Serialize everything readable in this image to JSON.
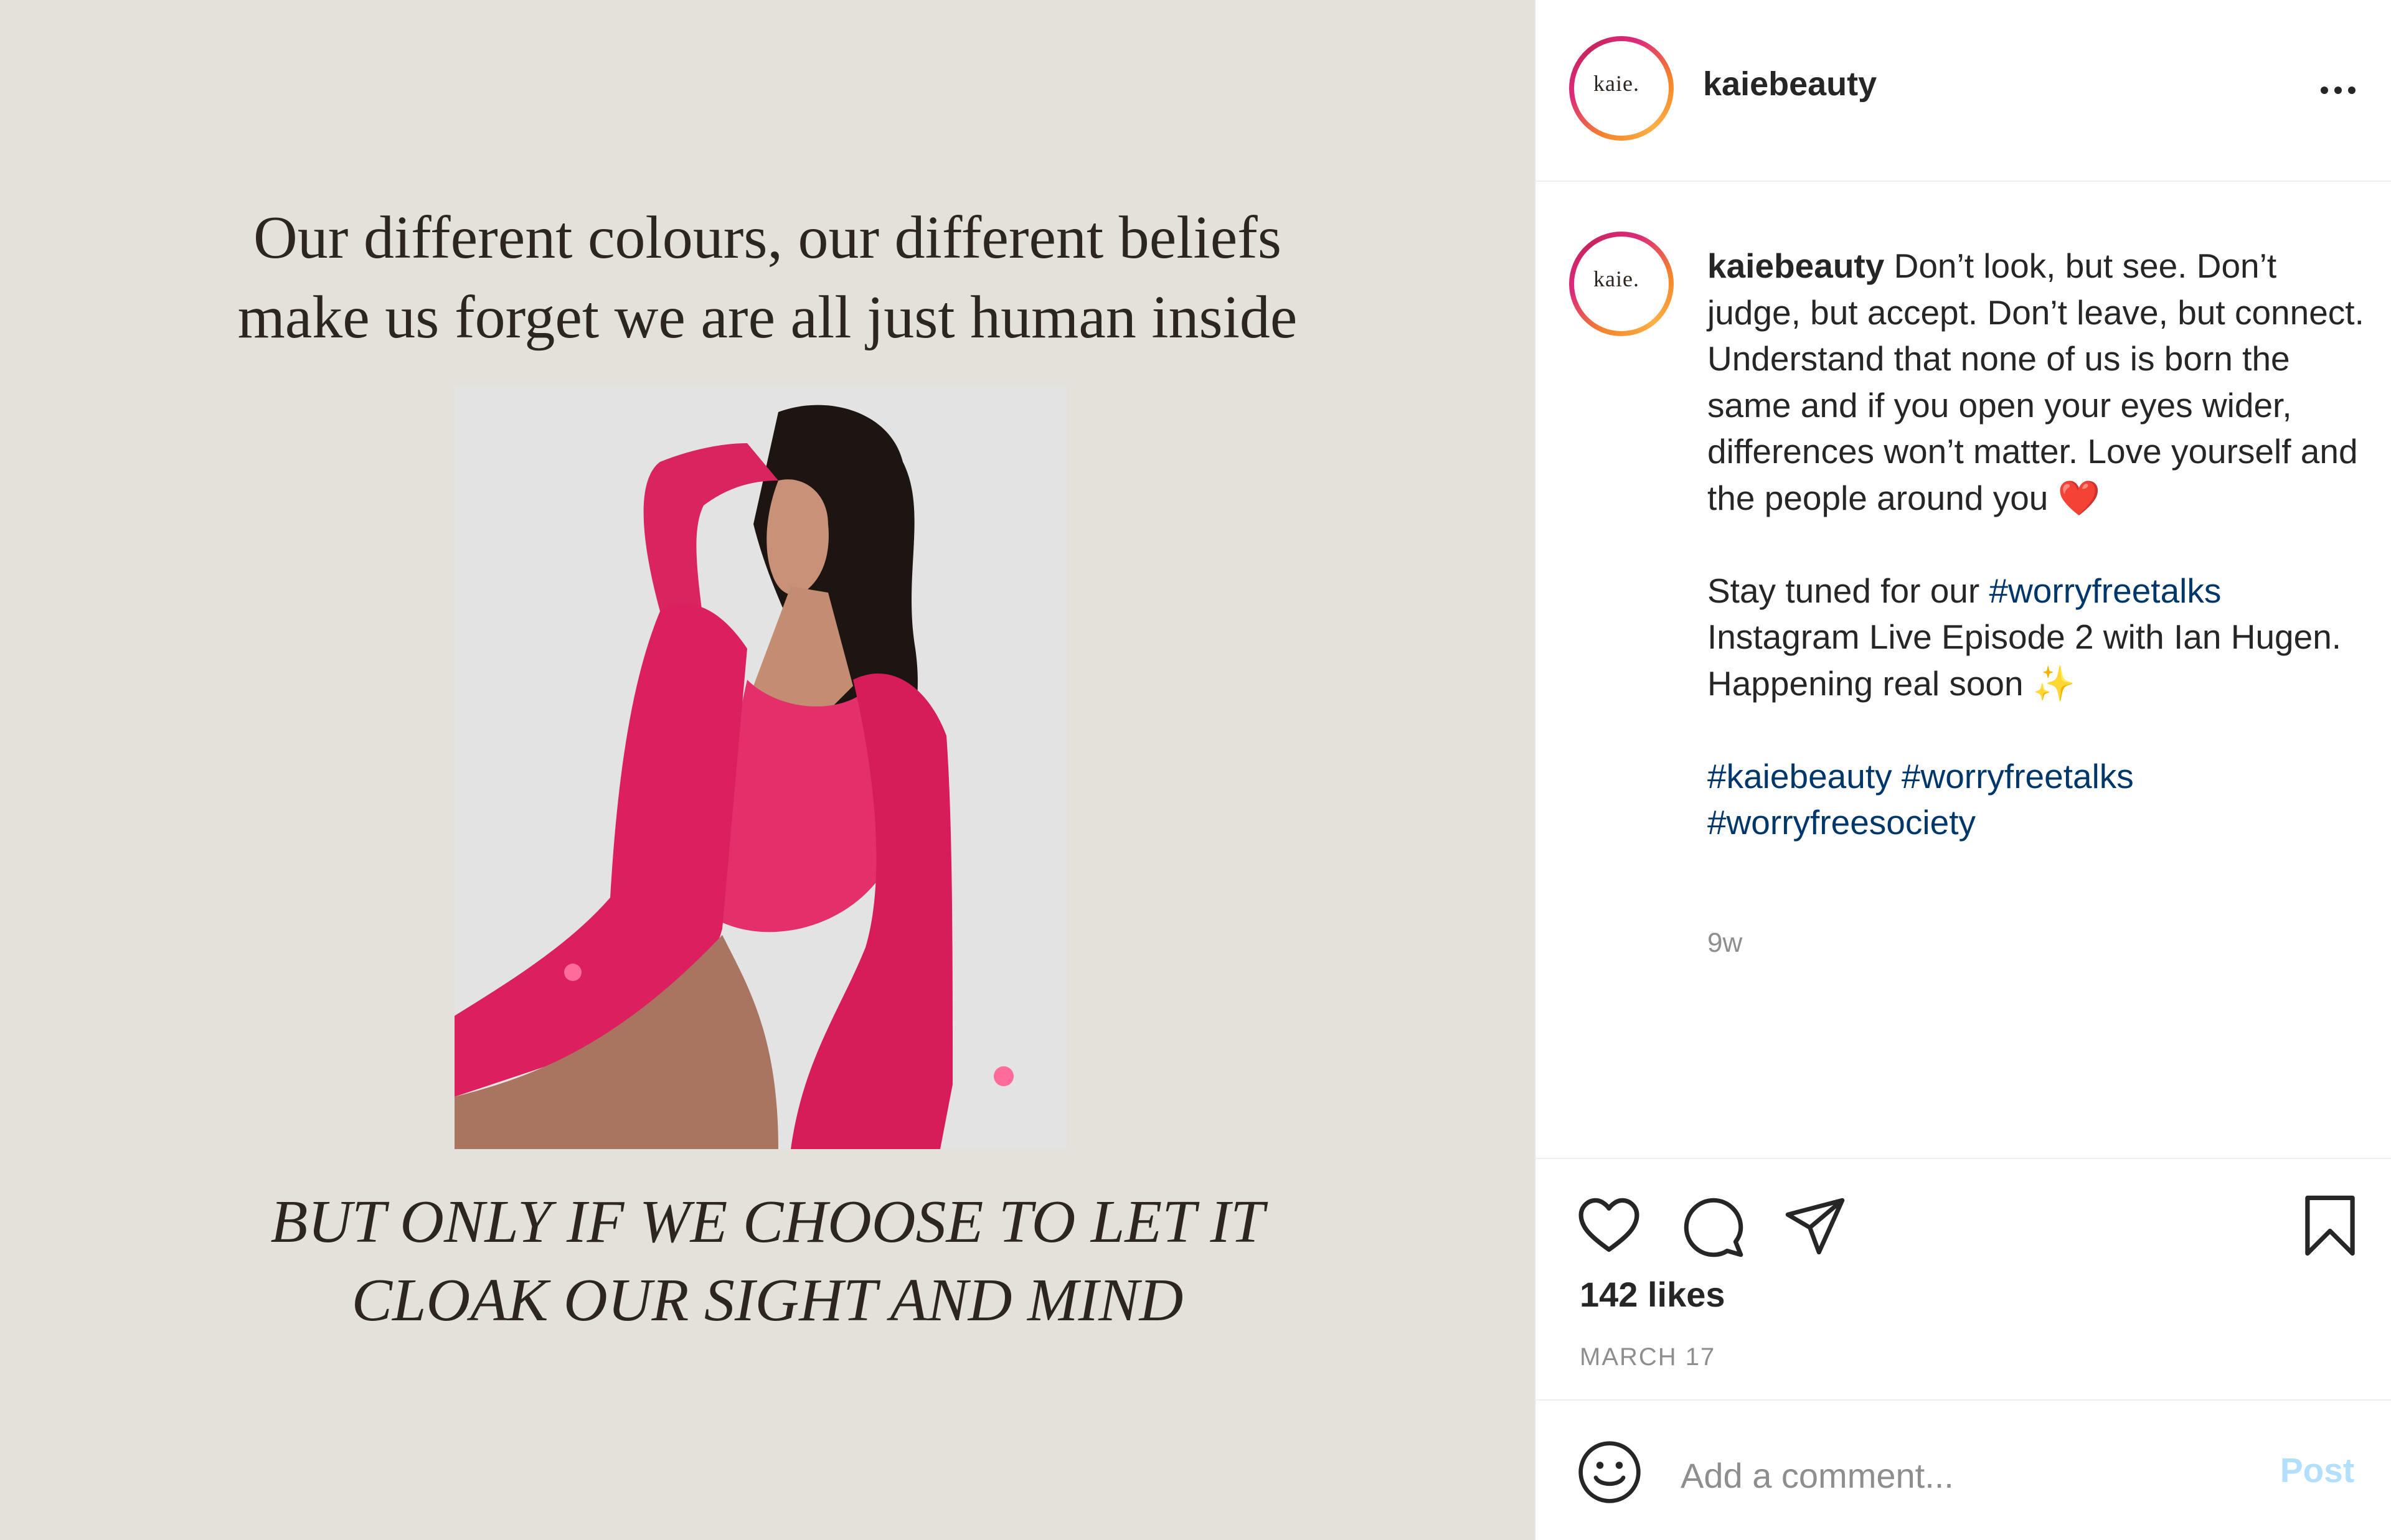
{
  "post": {
    "username": "kaiebeauty",
    "avatar_text": "kaie.",
    "image": {
      "quote_top_line1": "Our different colours, our different beliefs",
      "quote_top_line2": "make us forget we are all just human inside",
      "quote_bottom_line1": "BUT ONLY IF WE CHOOSE TO LET IT",
      "quote_bottom_line2": "CLOAK OUR SIGHT AND MIND"
    },
    "caption": {
      "username": "kaiebeauty",
      "text_1": " Don’t look, but see. Don’t judge, but accept. Don’t leave, but connect. Understand that none of us is born the same and if you open your eyes wider, differences won’t matter. Love yourself and the people around you ",
      "emoji_heart": "❤️",
      "text_2a": "Stay tuned for our ",
      "hashtag_1": "#worryfreetalks",
      "text_2b": " Instagram Live Episode 2 with Ian Hugen. Happening real soon ",
      "emoji_sparkles": "✨",
      "hashtag_2": "#kaiebeauty",
      "hashtag_3": "#worryfreetalks",
      "hashtag_4": "#worryfreesociety"
    },
    "time_ago": "9w",
    "likes": "142 likes",
    "date": "MARCH 17"
  },
  "comment_box": {
    "placeholder": "Add a comment...",
    "post_label": "Post"
  },
  "icons": {
    "like": "heart-icon",
    "comment": "comment-icon",
    "share": "paper-plane-icon",
    "save": "bookmark-icon",
    "emoji": "smiley-icon",
    "more": "more-options-icon"
  },
  "colors": {
    "image_background": "#e4e1da",
    "hashtag": "#00376b",
    "post_button_disabled": "#b2dffc",
    "muted_text": "#8e8e8e"
  }
}
